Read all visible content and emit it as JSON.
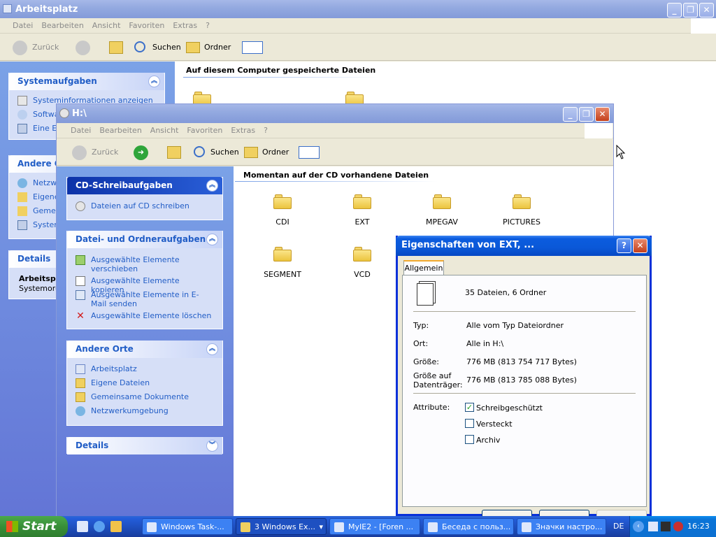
{
  "back_window": {
    "title": "Arbeitsplatz",
    "menu": [
      "Datei",
      "Bearbeiten",
      "Ansicht",
      "Favoriten",
      "Extras",
      "?"
    ],
    "toolbar": {
      "back": "Zurück",
      "search": "Suchen",
      "folders": "Ordner"
    },
    "content_heading": "Auf diesem Computer gespeicherte Dateien",
    "sys_panel": {
      "title": "Systemaufgaben",
      "items": [
        "Systeminformationen anzeigen",
        "Software",
        "Eine E"
      ]
    },
    "other_panel": {
      "title": "Andere O",
      "items": [
        "Netzw",
        "Eigene",
        "Gemei",
        "Syster"
      ]
    },
    "details_panel": {
      "title": "Details",
      "name": "Arbeitspl",
      "sub": "Systemord"
    }
  },
  "front_window": {
    "title": "H:\\",
    "menu": [
      "Datei",
      "Bearbeiten",
      "Ansicht",
      "Favoriten",
      "Extras",
      "?"
    ],
    "toolbar": {
      "back": "Zurück",
      "search": "Suchen",
      "folders": "Ordner"
    },
    "content_heading": "Momentan auf der CD vorhandene Dateien",
    "cd_panel": {
      "title": "CD-Schreibaufgaben",
      "items": [
        "Dateien auf CD schreiben"
      ]
    },
    "file_panel": {
      "title": "Datei- und Ordneraufgaben",
      "items": [
        "Ausgewählte Elemente verschieben",
        "Ausgewählte Elemente kopieren",
        "Ausgewählte Elemente in E-Mail senden",
        "Ausgewählte Elemente löschen"
      ]
    },
    "places_panel": {
      "title": "Andere Orte",
      "items": [
        "Arbeitsplatz",
        "Eigene Dateien",
        "Gemeinsame Dokumente",
        "Netzwerkumgebung"
      ]
    },
    "details_panel": {
      "title": "Details"
    },
    "folders": [
      "CDI",
      "EXT",
      "MPEGAV",
      "PICTURES",
      "SEGMENT",
      "VCD"
    ]
  },
  "dialog": {
    "title": "Eigenschaften von EXT, ...",
    "help_btn": "?",
    "tab": "Allgemein",
    "summary": "35 Dateien, 6 Ordner",
    "type_label": "Typ:",
    "type_value": "Alle vom Typ Dateiordner",
    "location_label": "Ort:",
    "location_value": "Alle in H:\\",
    "size_label": "Größe:",
    "size_value": "776 MB (813 754 717 Bytes)",
    "disk_label_1": "Größe auf",
    "disk_label_2": "Datenträger:",
    "disk_value": "776 MB (813 785 088 Bytes)",
    "attributes_label": "Attribute:",
    "attributes": [
      {
        "label": "Schreibgeschützt",
        "checked": true
      },
      {
        "label": "Versteckt",
        "checked": false
      },
      {
        "label": "Archiv",
        "checked": false
      }
    ]
  },
  "taskbar": {
    "start": "Start",
    "tasks": [
      "Windows Task-...",
      "3 Windows Ex...",
      "MyIE2 - [Foren ...",
      "Беседа с польз...",
      "Значки настро..."
    ],
    "language": "DE",
    "clock": "16:23"
  }
}
